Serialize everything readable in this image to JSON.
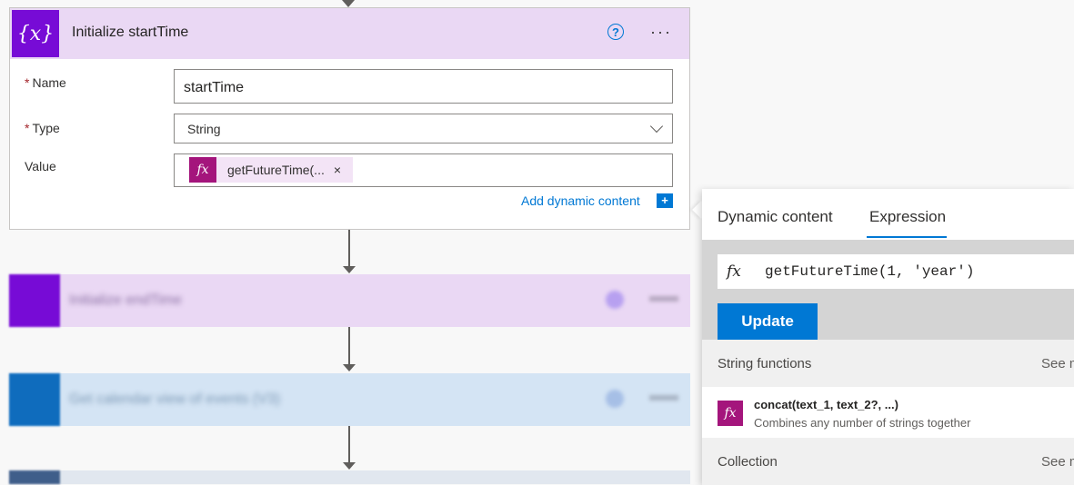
{
  "action_card": {
    "icon_glyph": "{x}",
    "title": "Initialize startTime",
    "help_glyph": "?",
    "more_glyph": "···",
    "required_marker": "*",
    "name_label": "Name",
    "name_value": "startTime",
    "type_label": "Type",
    "type_value": "String",
    "value_label": "Value",
    "token_icon": "fx",
    "token_text": "getFutureTime(...",
    "token_remove": "×",
    "add_dynamic_label": "Add dynamic content",
    "add_dynamic_icon": "+"
  },
  "blurred_steps": [
    {
      "title": "Initialize endTime",
      "icon_color": "#770bd6",
      "bg": "#ead8f4"
    },
    {
      "title": "Get calendar view of events (V3)",
      "icon_color": "#0f6cbd",
      "bg": "#d4e4f4"
    }
  ],
  "expression_panel": {
    "tabs": [
      {
        "label": "Dynamic content",
        "active": false
      },
      {
        "label": "Expression",
        "active": true
      }
    ],
    "fx_glyph": "fx",
    "expression_value": "getFutureTime(1, 'year')",
    "update_label": "Update",
    "sections": [
      {
        "label": "String functions",
        "see_more": "See m"
      },
      {
        "label": "Collection",
        "see_more": "See m"
      }
    ],
    "function_item": {
      "icon": "fx",
      "name": "concat(text_1, text_2?, ...)",
      "description": "Combines any number of strings together"
    }
  },
  "colors": {
    "accent": "#0078d4",
    "variable_purple": "#770bd6",
    "expression_magenta": "#a4157c",
    "header_lilac": "#ead8f4"
  }
}
